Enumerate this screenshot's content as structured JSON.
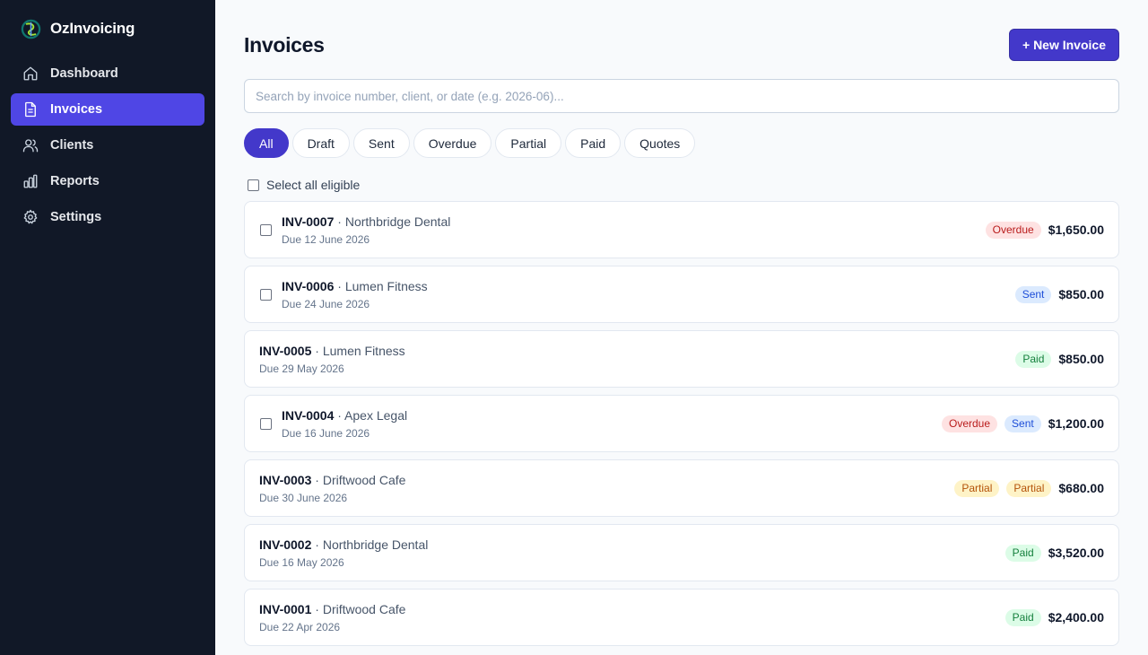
{
  "brand": {
    "name": "OzInvoicing"
  },
  "sidebar": {
    "items": [
      {
        "label": "Dashboard",
        "icon": "home-icon"
      },
      {
        "label": "Invoices",
        "icon": "document-icon",
        "active": true
      },
      {
        "label": "Clients",
        "icon": "users-icon"
      },
      {
        "label": "Reports",
        "icon": "bar-chart-icon"
      },
      {
        "label": "Settings",
        "icon": "gear-icon"
      }
    ]
  },
  "header": {
    "title": "Invoices",
    "new_button_label": "+ New Invoice"
  },
  "search": {
    "placeholder": "Search by invoice number, client, or date (e.g. 2026-06)...",
    "value": ""
  },
  "filters": [
    "All",
    "Draft",
    "Sent",
    "Overdue",
    "Partial",
    "Paid",
    "Quotes"
  ],
  "active_filter": "All",
  "select_all_label": "Select all eligible",
  "colors": {
    "sidebar_bg": "#111827",
    "accent": "#4338ca",
    "overdue": "#b91c1c",
    "sent": "#1d4ed8",
    "paid": "#15803d",
    "partial": "#b45309"
  },
  "invoices": [
    {
      "number": "INV-0007",
      "client": "Northbridge Dental",
      "due": "Due 12 June 2026",
      "badges": [
        "Overdue"
      ],
      "amount": "$1,650.00",
      "selectable": true
    },
    {
      "number": "INV-0006",
      "client": "Lumen Fitness",
      "due": "Due 24 June 2026",
      "badges": [
        "Sent"
      ],
      "amount": "$850.00",
      "selectable": true
    },
    {
      "number": "INV-0005",
      "client": "Lumen Fitness",
      "due": "Due 29 May 2026",
      "badges": [
        "Paid"
      ],
      "amount": "$850.00",
      "selectable": false
    },
    {
      "number": "INV-0004",
      "client": "Apex Legal",
      "due": "Due 16 June 2026",
      "badges": [
        "Overdue",
        "Sent"
      ],
      "amount": "$1,200.00",
      "selectable": true
    },
    {
      "number": "INV-0003",
      "client": "Driftwood Cafe",
      "due": "Due 30 June 2026",
      "badges": [
        "Partial",
        "Partial"
      ],
      "amount": "$680.00",
      "selectable": false
    },
    {
      "number": "INV-0002",
      "client": "Northbridge Dental",
      "due": "Due 16 May 2026",
      "badges": [
        "Paid"
      ],
      "amount": "$3,520.00",
      "selectable": false
    },
    {
      "number": "INV-0001",
      "client": "Driftwood Cafe",
      "due": "Due 22 Apr 2026",
      "badges": [
        "Paid"
      ],
      "amount": "$2,400.00",
      "selectable": false
    }
  ]
}
